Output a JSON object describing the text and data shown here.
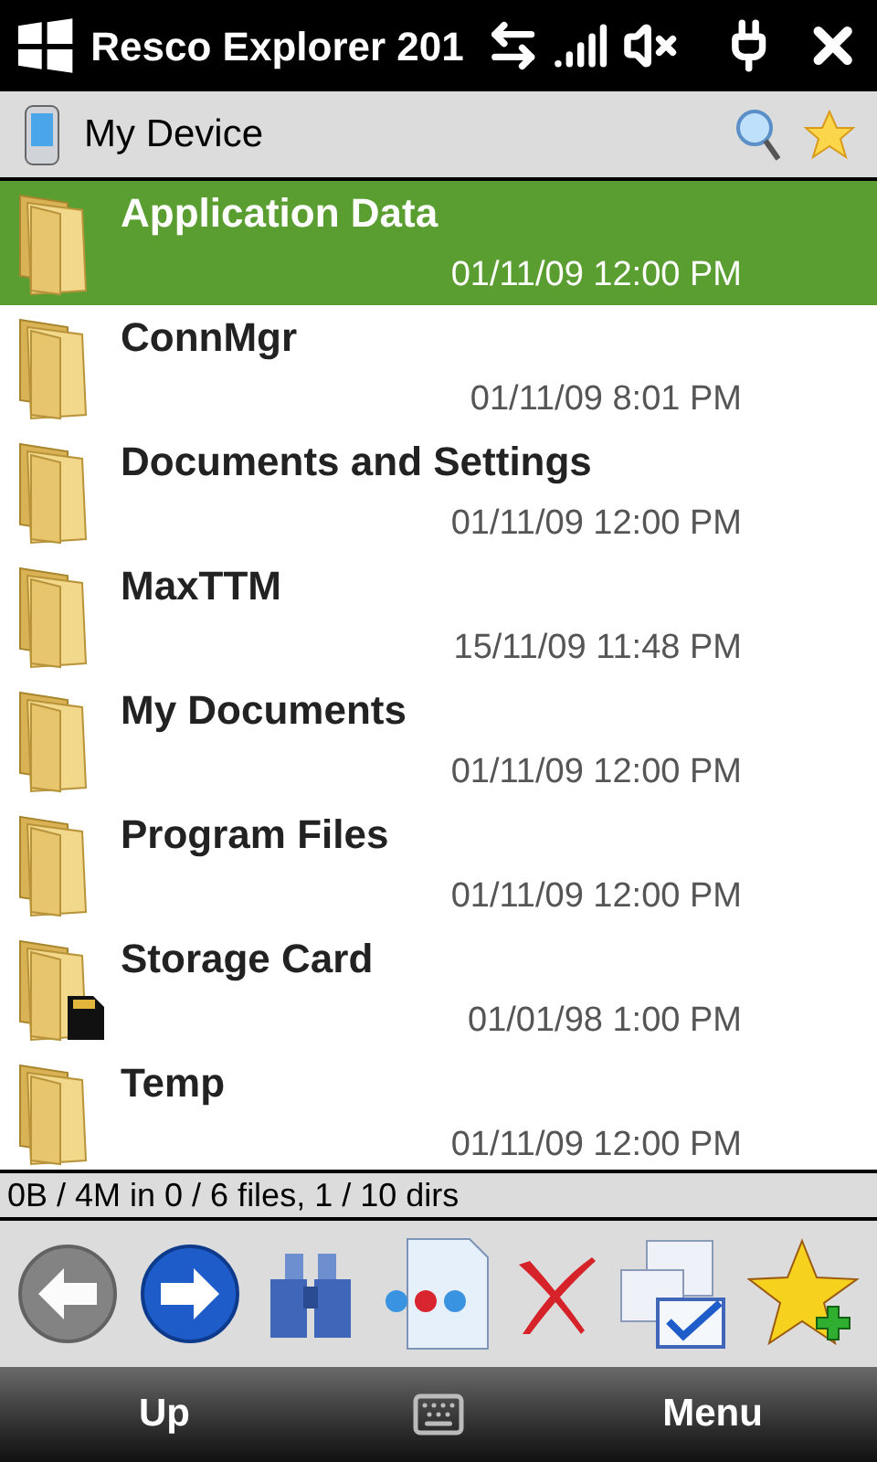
{
  "title_bar": {
    "title": "Resco Explorer 201"
  },
  "location": {
    "path": "My Device"
  },
  "rows": [
    {
      "kind": "folder",
      "name": "Application Data",
      "date": "01/11/09 12:00 PM",
      "selected": true
    },
    {
      "kind": "folder",
      "name": "ConnMgr",
      "date": "01/11/09 8:01 PM",
      "selected": false
    },
    {
      "kind": "folder",
      "name": "Documents and Settings",
      "date": "01/11/09 12:00 PM",
      "selected": false
    },
    {
      "kind": "folder",
      "name": "MaxTTM",
      "date": "15/11/09 11:48 PM",
      "selected": false
    },
    {
      "kind": "folder",
      "name": "My Documents",
      "date": "01/11/09 12:00 PM",
      "selected": false
    },
    {
      "kind": "folder",
      "name": "Program Files",
      "date": "01/11/09 12:00 PM",
      "selected": false
    },
    {
      "kind": "card",
      "name": "Storage Card",
      "date": "01/01/98 1:00 PM",
      "selected": false
    },
    {
      "kind": "folder",
      "name": "Temp",
      "date": "01/11/09 12:00 PM",
      "selected": false
    }
  ],
  "status_bar": "0B / 4M in 0 / 6 files, 1 / 10 dirs",
  "toolbar": [
    {
      "kind": "back",
      "disabled": true
    },
    {
      "kind": "forward",
      "disabled": false
    },
    {
      "kind": "find",
      "disabled": false
    },
    {
      "kind": "properties",
      "disabled": false
    },
    {
      "kind": "delete",
      "disabled": false
    },
    {
      "kind": "select",
      "disabled": false
    },
    {
      "kind": "favorite",
      "disabled": false
    }
  ],
  "softkeys": {
    "left": "Up",
    "right": "Menu"
  }
}
